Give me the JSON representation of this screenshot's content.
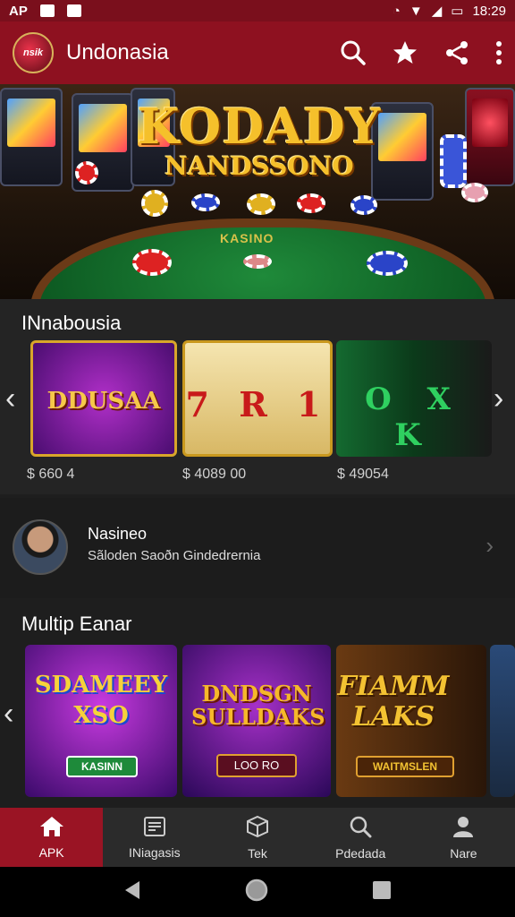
{
  "status_bar": {
    "left_text": "AP",
    "time": "18:29"
  },
  "app_bar": {
    "logo_text": "nsik",
    "title": "Undonasia"
  },
  "hero": {
    "title_line1": "KODADY",
    "title_line2": "NANDSSONO",
    "table_label": "KASINO"
  },
  "section1": {
    "title": "INnabousia",
    "cards": [
      {
        "label": "DDUSAA",
        "price": "$ 660 4"
      },
      {
        "label": "7 R 1",
        "price": "$ 4089 00"
      },
      {
        "label": "O X K",
        "price": "$ 49054"
      }
    ]
  },
  "user_row": {
    "name": "Nasineo",
    "subtitle": "Sãloden Saoðn Gindedrernia"
  },
  "section2": {
    "title": "Multip Eanar",
    "cards": [
      {
        "title": "SDAMEEY XSO",
        "button": "KASINN"
      },
      {
        "title": "DNDSGN SULLDAKS",
        "button": "LOO RO"
      },
      {
        "title": "FIAMM LAKS",
        "button": "WAITMSLEN"
      }
    ]
  },
  "bottom_nav": [
    {
      "label": "APK",
      "icon": "home-icon"
    },
    {
      "label": "INiagasis",
      "icon": "news-icon"
    },
    {
      "label": "Tek",
      "icon": "cube-icon"
    },
    {
      "label": "Pdedada",
      "icon": "search-icon"
    },
    {
      "label": "Nare",
      "icon": "person-icon"
    }
  ],
  "colors": {
    "primary": "#8e1120",
    "active_tab": "#9a1424",
    "background": "#1e1e1e"
  }
}
